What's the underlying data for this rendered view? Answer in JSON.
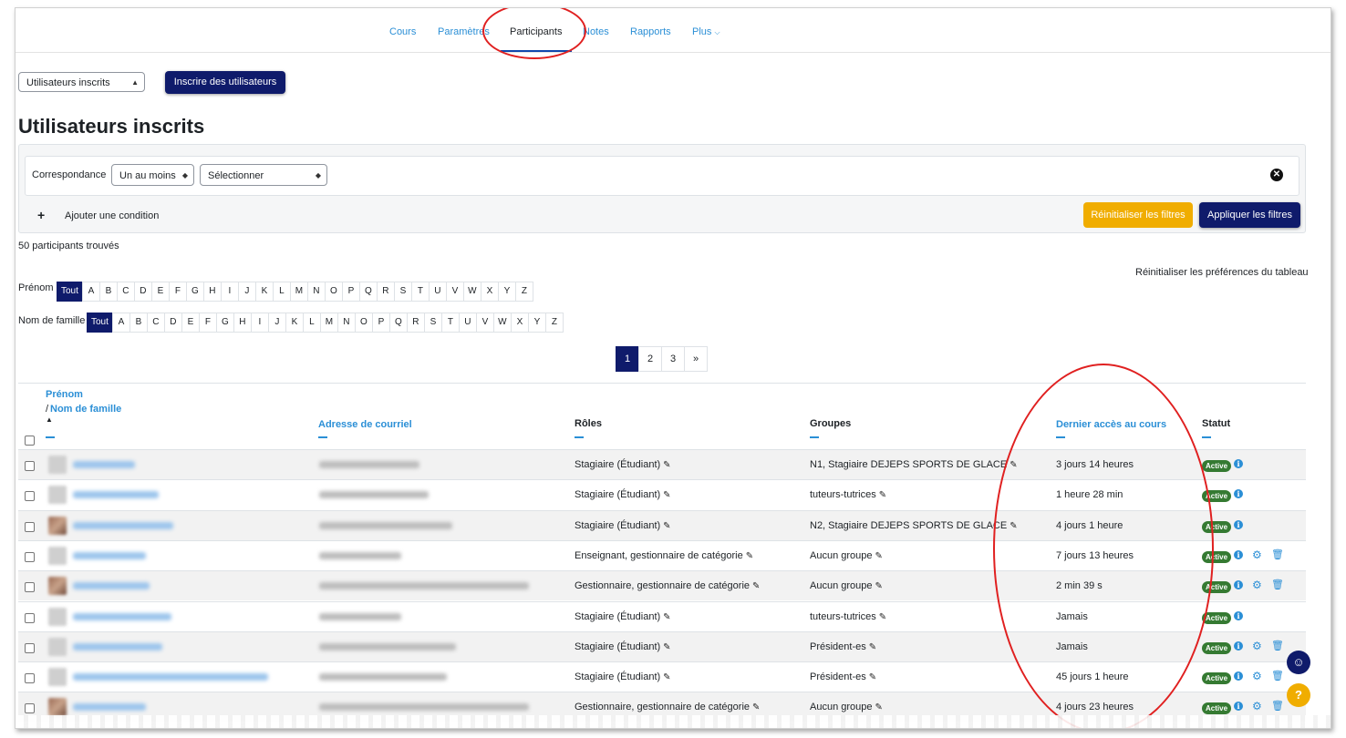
{
  "nav": {
    "items": [
      {
        "label": "Cours"
      },
      {
        "label": "Paramètres"
      },
      {
        "label": "Participants"
      },
      {
        "label": "Notes"
      },
      {
        "label": "Rapports"
      },
      {
        "label": "Plus"
      }
    ]
  },
  "toolbar": {
    "enrolment_select": "Utilisateurs inscrits",
    "enrol_button": "Inscrire des utilisateurs"
  },
  "page_title": "Utilisateurs inscrits",
  "filters": {
    "match_label": "Correspondance",
    "match_select": "Un au moins",
    "type_select": "Sélectionner",
    "add_condition": "Ajouter une condition",
    "reset_button": "Réinitialiser les filtres",
    "apply_button": "Appliquer les filtres"
  },
  "count_text": "50 participants trouvés",
  "reset_prefs": "Réinitialiser les préférences du tableau",
  "initials": {
    "firstname_label": "Prénom",
    "lastname_label": "Nom de famille",
    "all": "Tout",
    "letters": [
      "A",
      "B",
      "C",
      "D",
      "E",
      "F",
      "G",
      "H",
      "I",
      "J",
      "K",
      "L",
      "M",
      "N",
      "O",
      "P",
      "Q",
      "R",
      "S",
      "T",
      "U",
      "V",
      "W",
      "X",
      "Y",
      "Z"
    ]
  },
  "pagination": [
    "1",
    "2",
    "3",
    "»"
  ],
  "table": {
    "headers": {
      "firstname": "Prénom",
      "slash": "/",
      "lastname": "Nom de famille",
      "email": "Adresse de courriel",
      "roles": "Rôles",
      "groups": "Groupes",
      "lastaccess": "Dernier accès au cours",
      "status": "Statut"
    },
    "status_badge": "Active",
    "rows": [
      {
        "role": "Stagiaire (Étudiant)",
        "group": "N1, Stagiaire DEJEPS SPORTS DE GLACE",
        "access": "3 jours 14 heures",
        "photo": false,
        "admin": false
      },
      {
        "role": "Stagiaire (Étudiant)",
        "group": "tuteurs-tutrices",
        "access": "1 heure 28 min",
        "photo": false,
        "admin": false
      },
      {
        "role": "Stagiaire (Étudiant)",
        "group": "N2, Stagiaire DEJEPS SPORTS DE GLACE",
        "access": "4 jours 1 heure",
        "photo": true,
        "admin": false
      },
      {
        "role": "Enseignant, gestionnaire de catégorie",
        "group": "Aucun groupe",
        "access": "7 jours 13 heures",
        "photo": false,
        "admin": true
      },
      {
        "role": "Gestionnaire, gestionnaire de catégorie",
        "group": "Aucun groupe",
        "access": "2 min 39 s",
        "photo": true,
        "admin": true
      },
      {
        "role": "Stagiaire (Étudiant)",
        "group": "tuteurs-tutrices",
        "access": "Jamais",
        "photo": false,
        "admin": false
      },
      {
        "role": "Stagiaire (Étudiant)",
        "group": "Président-es",
        "access": "Jamais",
        "photo": false,
        "admin": true
      },
      {
        "role": "Stagiaire (Étudiant)",
        "group": "Président-es",
        "access": "45 jours 1 heure",
        "photo": false,
        "admin": true
      },
      {
        "role": "Gestionnaire, gestionnaire de catégorie",
        "group": "Aucun groupe",
        "access": "4 jours 23 heures",
        "photo": true,
        "admin": true
      }
    ]
  },
  "colors": {
    "primary": "#0f1b6b",
    "warning": "#f0ad00",
    "link": "#2b8fd6",
    "success": "#357a32",
    "annotation": "#e02020"
  }
}
